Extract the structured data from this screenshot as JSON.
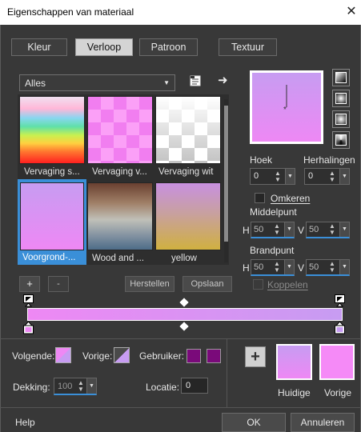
{
  "window": {
    "title": "Eigenschappen van materiaal"
  },
  "tabs": [
    {
      "label": "Kleur",
      "active": false
    },
    {
      "label": "Verloop",
      "active": true
    },
    {
      "label": "Patroon",
      "active": false
    },
    {
      "label": "Textuur",
      "active": false
    }
  ],
  "gradient_list": {
    "category": "Alles",
    "items": [
      {
        "label": "Vervaging s..."
      },
      {
        "label": "Vervaging v..."
      },
      {
        "label": "Vervaging wit"
      },
      {
        "label": "Voorgrond-...",
        "selected": true
      },
      {
        "label": "Wood and ..."
      },
      {
        "label": "yellow"
      }
    ]
  },
  "editor_buttons": {
    "add": "+",
    "remove": "-",
    "reset": "Herstellen",
    "save": "Opslaan"
  },
  "angle": {
    "label": "Hoek",
    "value": "0"
  },
  "repeats": {
    "label": "Herhalingen",
    "value": "0"
  },
  "invert": {
    "label": "Omkeren",
    "checked": false
  },
  "center": {
    "label": "Middelpunt",
    "h_label": "H",
    "h_value": "50",
    "v_label": "V",
    "v_value": "50"
  },
  "focal": {
    "label": "Brandpunt",
    "h_label": "H",
    "h_value": "50",
    "v_label": "V",
    "v_value": "50"
  },
  "link": {
    "label": "Koppelen",
    "checked": false
  },
  "stops": {
    "next_label": "Volgende:",
    "prev_label": "Vorige:",
    "user_label": "Gebruiker:",
    "opacity_label": "Dekking:",
    "opacity_value": "100",
    "location_label": "Locatie:",
    "location_value": "0"
  },
  "colors": {
    "gradient_start": "#ee88f4",
    "gradient_end": "#c79cf2",
    "user_color": "#7a0a7a",
    "accent": "#3a8fd8"
  },
  "swatches": {
    "current_label": "Huidige",
    "previous_label": "Vorige"
  },
  "footer": {
    "help": "Help",
    "ok": "OK",
    "cancel": "Annuleren"
  }
}
